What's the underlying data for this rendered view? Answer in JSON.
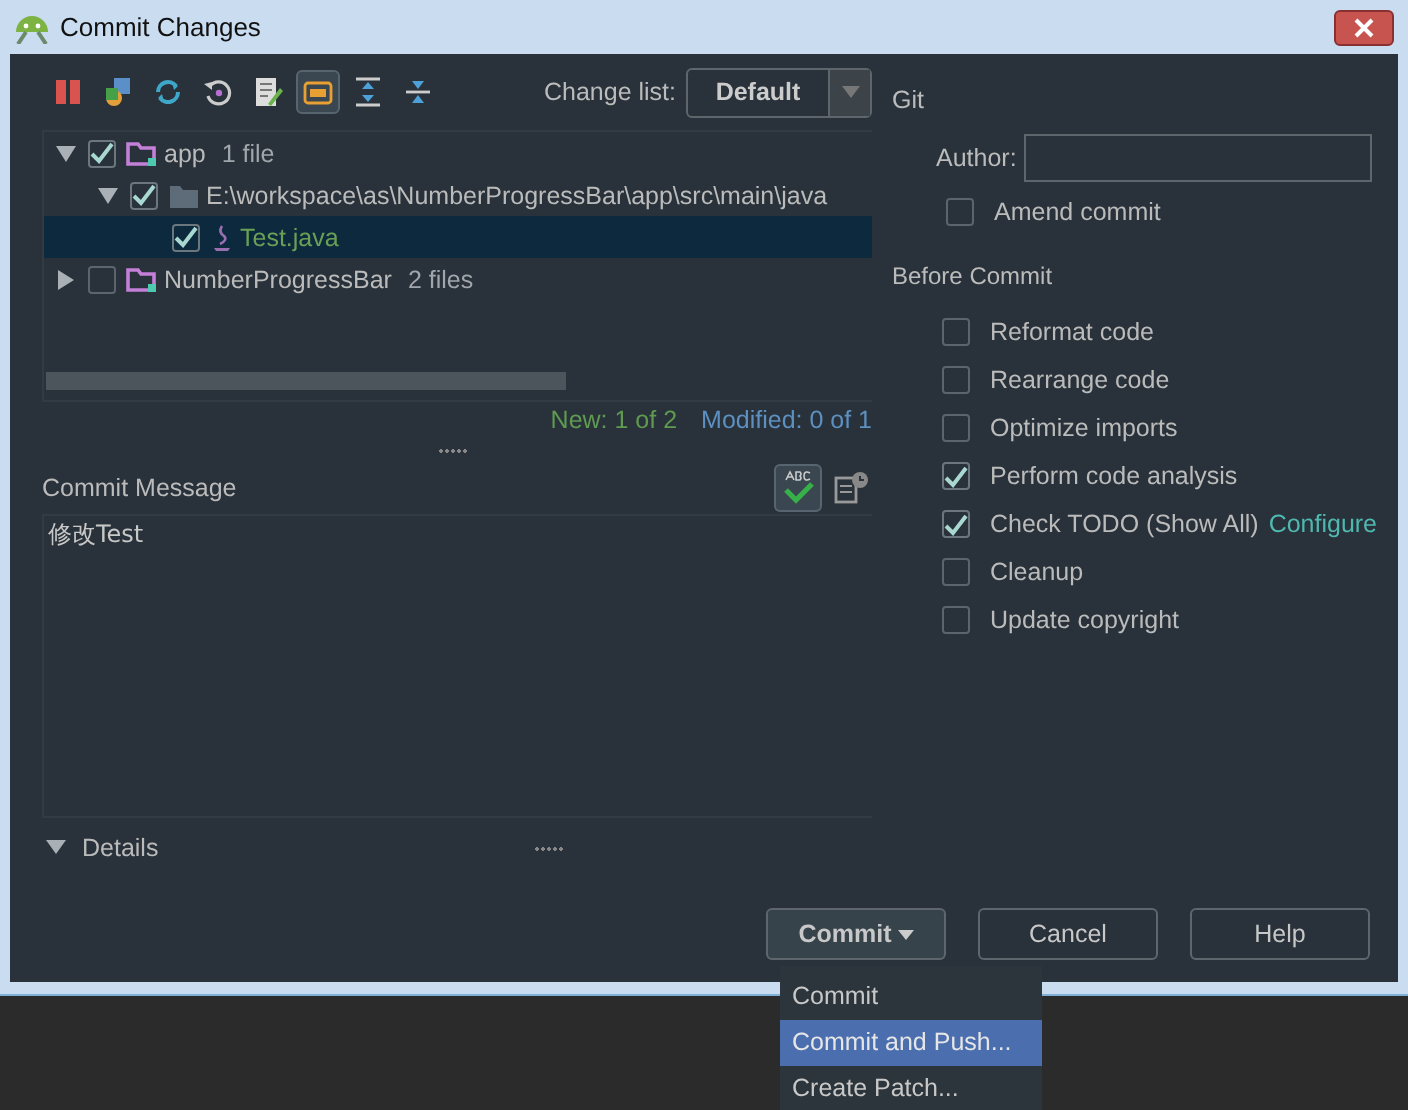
{
  "window": {
    "title": "Commit Changes"
  },
  "toolbar": [
    {
      "kind": "diff",
      "selected": false
    },
    {
      "kind": "move",
      "selected": false
    },
    {
      "kind": "refresh",
      "selected": false
    },
    {
      "kind": "rollback",
      "selected": false
    },
    {
      "kind": "edit",
      "selected": false
    },
    {
      "kind": "group",
      "selected": true
    },
    {
      "kind": "expand",
      "selected": false
    },
    {
      "kind": "collapse",
      "selected": false
    }
  ],
  "change_list": {
    "label": "Change list:",
    "value": "Default"
  },
  "tree": [
    {
      "kind": "module",
      "label": "app",
      "count": "1 file",
      "checked": true,
      "expanded": true,
      "selected": false,
      "children": [
        {
          "kind": "folder",
          "label": "E:\\workspace\\as\\NumberProgressBar\\app\\src\\main\\java",
          "checked": true,
          "expanded": true,
          "selected": false,
          "children": [
            {
              "kind": "file",
              "label": "Test.java",
              "checked": true,
              "selected": true
            }
          ]
        }
      ]
    },
    {
      "kind": "module",
      "label": "NumberProgressBar",
      "count": "2 files",
      "checked": false,
      "expanded": false,
      "selected": false
    }
  ],
  "stats": {
    "new": "New: 1 of 2",
    "modified": "Modified: 0 of 1"
  },
  "commit_message": {
    "label": "Commit Message",
    "value": "修改Test"
  },
  "details": {
    "label": "Details",
    "expanded": true
  },
  "git": {
    "title": "Git",
    "author_label": "Author:",
    "amend": {
      "label": "Amend commit",
      "checked": false
    }
  },
  "before_commit": {
    "title": "Before Commit",
    "options": [
      {
        "label": "Reformat code",
        "checked": false
      },
      {
        "label": "Rearrange code",
        "checked": false
      },
      {
        "label": "Optimize imports",
        "checked": false
      },
      {
        "label": "Perform code analysis",
        "checked": true
      },
      {
        "label": "Check TODO (Show All)",
        "checked": true,
        "link": "Configure"
      },
      {
        "label": "Cleanup",
        "checked": false
      },
      {
        "label": "Update copyright",
        "checked": false
      }
    ]
  },
  "buttons": [
    {
      "label": "Commit",
      "kind": "split"
    },
    {
      "label": "Cancel",
      "kind": "plain"
    },
    {
      "label": "Help",
      "kind": "plain"
    }
  ],
  "menu": [
    {
      "label": "Commit",
      "selected": false
    },
    {
      "label": "Commit and Push...",
      "selected": true
    },
    {
      "label": "Create Patch...",
      "selected": false
    }
  ]
}
